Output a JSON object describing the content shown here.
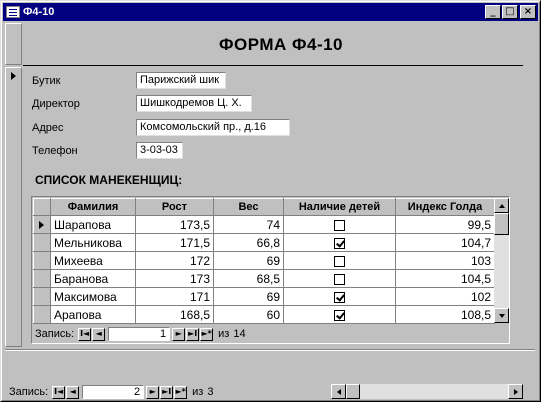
{
  "window": {
    "title": "Ф4-10"
  },
  "titlebar_buttons": {
    "minimize": "_",
    "maximize": "□",
    "close": "×"
  },
  "form": {
    "title": "ФОРМА  Ф4-10",
    "fields": [
      {
        "label": "Бутик",
        "value": "Парижский шик"
      },
      {
        "label": "Директор",
        "value": "Шишкодремов Ц. Х."
      },
      {
        "label": "Адрес",
        "value": "Комсомольский пр., д.16"
      },
      {
        "label": "Телефон",
        "value": "3-03-03"
      }
    ],
    "list_title": "СПИСОК МАНЕКЕНЩИЦ:"
  },
  "subform": {
    "columns": [
      "Фамилия",
      "Рост",
      "Вес",
      "Наличие детей",
      "Индекс Голда"
    ],
    "rows": [
      {
        "surname": "Шарапова",
        "height": "173,5",
        "weight": "74",
        "children": false,
        "index": "99,5"
      },
      {
        "surname": "Мельникова",
        "height": "171,5",
        "weight": "66,8",
        "children": true,
        "index": "104,7"
      },
      {
        "surname": "Михеева",
        "height": "172",
        "weight": "69",
        "children": false,
        "index": "103"
      },
      {
        "surname": "Баранова",
        "height": "173",
        "weight": "68,5",
        "children": false,
        "index": "104,5"
      },
      {
        "surname": "Максимова",
        "height": "171",
        "weight": "69",
        "children": true,
        "index": "102"
      },
      {
        "surname": "Арапова",
        "height": "168,5",
        "weight": "60",
        "children": true,
        "index": "108,5"
      }
    ],
    "nav": {
      "label": "Запись:",
      "current": "1",
      "of_label": "из",
      "total": "14"
    }
  },
  "main_nav": {
    "label": "Запись:",
    "current": "2",
    "of_label": "из",
    "total": "3"
  },
  "nav_buttons": {
    "first": "I◄",
    "prev": "◄",
    "next": "►",
    "last": "►I",
    "new": "►*"
  }
}
